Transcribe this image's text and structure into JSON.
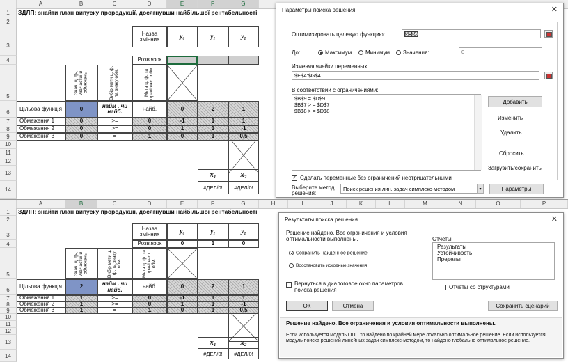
{
  "sheet": {
    "columns": [
      "A",
      "B",
      "C",
      "D",
      "E",
      "F",
      "G",
      "H",
      "I",
      "J",
      "K",
      "L",
      "M",
      "N",
      "O",
      "P"
    ],
    "rows": [
      "1",
      "2",
      "3",
      "4",
      "5",
      "6",
      "7",
      "8",
      "9",
      "10",
      "11",
      "12",
      "13",
      "14"
    ],
    "title": "ЗДЛП: знайти план випуску прородукції, досягнувши найбільшої рентабельності",
    "hdr_names": "Назва змінних",
    "y0": "y₀",
    "y1": "y₁",
    "y2": "y₂",
    "solution_label": "Розв'язок",
    "vert_b": "Знач. ц. ф-, лівічастини обмежень",
    "vert_c": "Вибір мети ц. ф. та знаку обм.",
    "vert_d": "Мета ц. ф. та праві част. обм.",
    "target_label": "Цільова функція",
    "constraints": [
      "Обмеження 1",
      "Обмеження 2",
      "Обмеження 3"
    ],
    "signs": [
      "найм . чи найб.",
      ">=",
      ">=",
      "="
    ],
    "d_vals": [
      "найб.",
      "0",
      "0",
      "1"
    ],
    "coef_rows": [
      [
        "0",
        "2",
        "1"
      ],
      [
        "-1",
        "1",
        "1"
      ],
      [
        "1",
        "1",
        "-1"
      ],
      [
        "0",
        "1",
        "0,5"
      ]
    ],
    "x1": "x₁",
    "x2": "x₂",
    "err": "#ДЕЛ/0!",
    "top_b_vals": [
      "0",
      "0",
      "0",
      "0"
    ],
    "top_solution": [
      "",
      "",
      ""
    ],
    "bottom_b_vals": [
      "2",
      "1",
      "1",
      "1"
    ],
    "bottom_solution": [
      "0",
      "1",
      "0"
    ]
  },
  "solver": {
    "title": "Параметры поиска решения",
    "close": "✕",
    "optimize_label": "Оптимизировать целевую функцию:",
    "optimize_value": "$B$6",
    "to_label": "До:",
    "max_label": "Максимум",
    "min_label": "Минимум",
    "value_label": "Значения:",
    "value_input": "0",
    "vars_label": "Изменяя ячейки переменных:",
    "vars_value": "$E$4:$G$4",
    "constraints_label": "В соответствии с ограничениями:",
    "constraints": [
      "$B$9 = $D$9",
      "$B$7 > = $D$7",
      "$B$8 > = $D$8"
    ],
    "add": "Добавить",
    "change": "Изменить",
    "delete": "Удалить",
    "reset": "Сбросить",
    "load_save": "Загрузить/сохранить",
    "nonneg_label": "Сделать переменные без ограничений неотрицательными",
    "method_label": "Выберите метод решения:",
    "method_value": "Поиск решения лин. задач симплекс-методом",
    "params": "Параметры"
  },
  "results": {
    "title": "Результаты поиска решения",
    "close": "✕",
    "msg": "Решение найдено. Все ограничения и условия оптимальности выполнены.",
    "reports_label": "Отчеты",
    "reports": [
      "Результаты",
      "Устойчивость",
      "Пределы"
    ],
    "keep": "Сохранить найденное решение",
    "restore": "Восстановить исходные значения",
    "return_label": "Вернуться в диалоговое окно параметров поиска решения",
    "outline_label": "Отчеты со структурами",
    "ok": "ОК",
    "cancel": "Отмена",
    "save_scenario": "Сохранить сценарий",
    "bold_msg": "Решение найдено. Все ограничения и условия оптимальности выполнены.",
    "detail": "Если используется модуль ОПГ, то найдено по крайней мере локально оптимальное решение. Если используется модуль поиска решений линейных задач симплекс-методом, то найдено глобально оптимальное решение."
  }
}
